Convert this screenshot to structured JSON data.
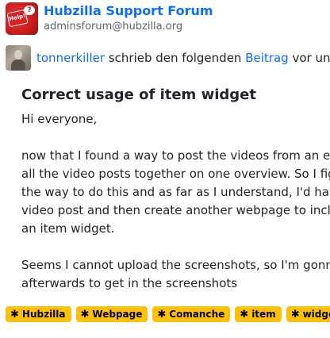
{
  "forum": {
    "name": "Hubzilla Support Forum",
    "address": "adminsforum@hubzilla.org",
    "avatar_label": "Help!",
    "avatar_bubble": "?"
  },
  "share": {
    "author": "tonnerkiller",
    "text_before_link": "schrieb den folgenden",
    "link": "Beitrag",
    "text_after_link": "vor ungefähr"
  },
  "post": {
    "title": "Correct usage of item widget",
    "greeting": "Hi everyone,",
    "paragraph1": [
      "now that I found a way to post the videos from an external",
      "all the video posts together on one overview. So I figured",
      "the way to do this and as far as I understand, I'd have to",
      "video post and then create another webpage to include the",
      "an item widget."
    ],
    "paragraph2": [
      "Seems I cannot upload the screenshots, so I'm gonna post",
      "afterwards to get in the screenshots"
    ]
  },
  "tags": [
    {
      "symbol": "✱",
      "label": "Hubzilla"
    },
    {
      "symbol": "✱",
      "label": "Webpage"
    },
    {
      "symbol": "✱",
      "label": "Comanche"
    },
    {
      "symbol": "✱",
      "label": "item"
    },
    {
      "symbol": "✱",
      "label": "widget"
    }
  ],
  "colors": {
    "link": "#0d6efd",
    "tag_background": "#ffc107",
    "text": "#212529",
    "muted": "#5c636a"
  }
}
